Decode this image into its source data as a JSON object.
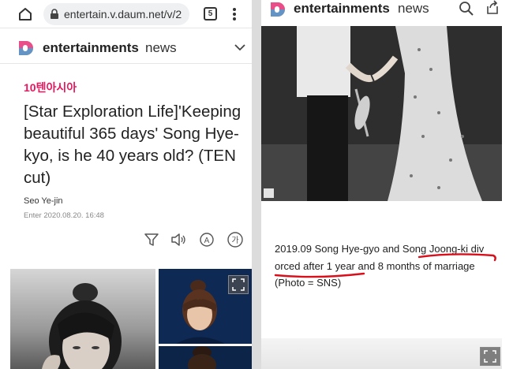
{
  "left": {
    "browser": {
      "url": "entertain.v.daum.net/v/2",
      "tab_count": "5"
    },
    "header": {
      "brand": "entertainments",
      "section": "news"
    },
    "article": {
      "publisher": "10텐아시아",
      "headline": "[Star Exploration Life]'Keeping beautiful 365 days' Song Hye-kyo, is he 40 years old? (TEN cut)",
      "author": "Seo Ye-jin",
      "date": "Enter  2020.08.20. 16:48"
    },
    "tools": [
      "filter-icon",
      "speaker-icon",
      "translate-icon",
      "text-size-icon"
    ],
    "tool_glyphs": {
      "translate": "A",
      "text_size": "가"
    }
  },
  "right": {
    "header": {
      "brand": "entertainments",
      "section": "news"
    },
    "caption": {
      "line1_a": "2019.09 Song Hye-gyo and Song ",
      "line1_b": "Joong-ki div",
      "line2_a": "orced after 1 year",
      "line2_b": " and 8 months of marriage",
      "line3": "(Photo = SNS)"
    }
  },
  "colors": {
    "accent_pink": "#e5175f",
    "annotation_red": "#d8101c",
    "daum_logo": [
      "#f5a623",
      "#e94e8b",
      "#4a90e2",
      "#7ed321"
    ]
  }
}
